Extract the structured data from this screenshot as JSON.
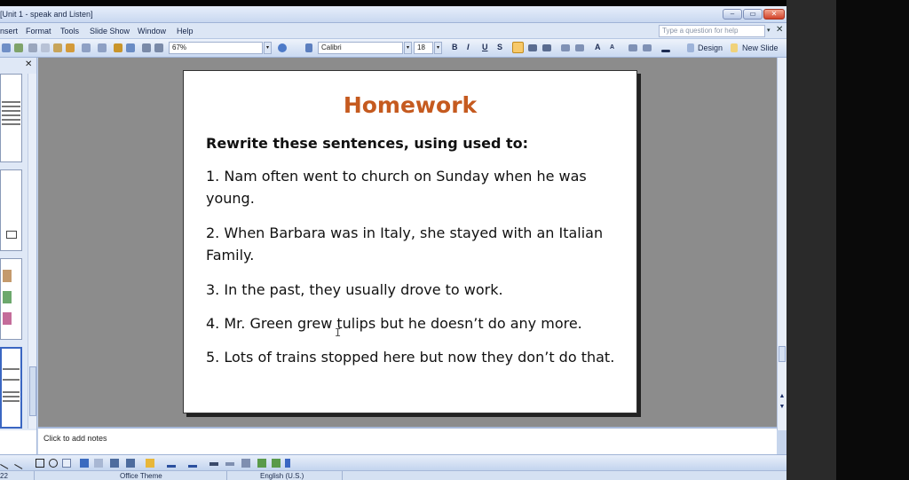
{
  "window": {
    "title": "[Unit 1 - speak and Listen]",
    "controls": {
      "minimize": "–",
      "maximize": "▭",
      "close": "✕"
    }
  },
  "menu": {
    "items": [
      "nsert",
      "Format",
      "Tools",
      "Slide Show",
      "Window",
      "Help"
    ],
    "help_placeholder": "Type a question for help",
    "help_arrow": "▾",
    "close": "✕"
  },
  "toolbar": {
    "zoom": "67%",
    "font": "Calibri",
    "font_size": "18",
    "bold": "B",
    "italic": "I",
    "underline": "U",
    "shadow": "S",
    "grow_font": "A",
    "shrink_font": "A",
    "design": "Design",
    "new_slide": "New Slide",
    "dropdown_arrow": "▾"
  },
  "left_pane": {
    "close": "✕"
  },
  "slide": {
    "title": "Homework",
    "subtitle": "Rewrite these sentences, using used to:",
    "sentences": [
      "1. Nam often went to church on Sunday when he was young.",
      "2. When Barbara was in Italy, she stayed with an Italian Family.",
      "3. In the past, they usually drove to work.",
      "4. Mr. Green grew tulips but he doesn’t do any more.",
      "5. Lots of trains stopped here but now they don’t do that."
    ]
  },
  "notes": {
    "placeholder": "Click to add notes"
  },
  "statusbar": {
    "slide_number": "22",
    "theme": "Office Theme",
    "language": "English (U.S.)"
  },
  "colors": {
    "title_orange": "#c55a1f",
    "ribbon_blue": "#c9d9f1",
    "canvas_gray": "#8c8c8c"
  }
}
